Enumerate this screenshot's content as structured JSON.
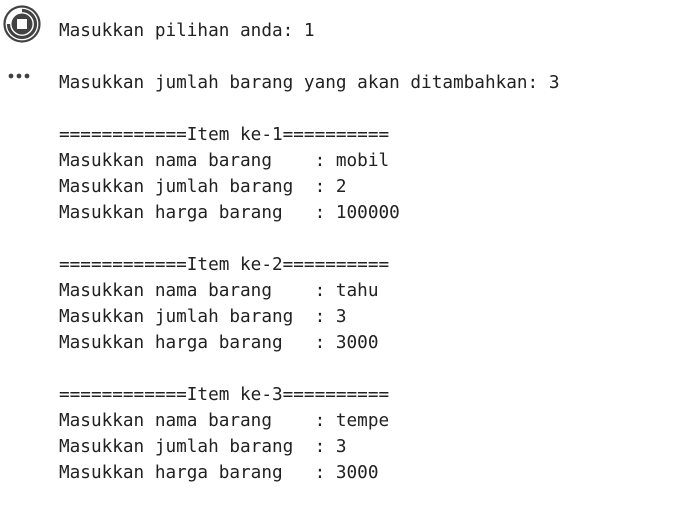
{
  "cell": {
    "run_button_icon": "stop-circle-icon",
    "more_icon": "more-horizontal-icon"
  },
  "output": {
    "lines": [
      "Masukkan pilihan anda: 1",
      "",
      "Masukkan jumlah barang yang akan ditambahkan: 3",
      "",
      "============Item ke-1==========",
      "Masukkan nama barang    : mobil",
      "Masukkan jumlah barang  : 2",
      "Masukkan harga barang   : 100000",
      "",
      "============Item ke-2==========",
      "Masukkan nama barang    : tahu",
      "Masukkan jumlah barang  : 3",
      "Masukkan harga barang   : 3000",
      "",
      "============Item ke-3==========",
      "Masukkan nama barang    : tempe",
      "Masukkan jumlah barang  : 3",
      "Masukkan harga barang   : 3000"
    ]
  }
}
